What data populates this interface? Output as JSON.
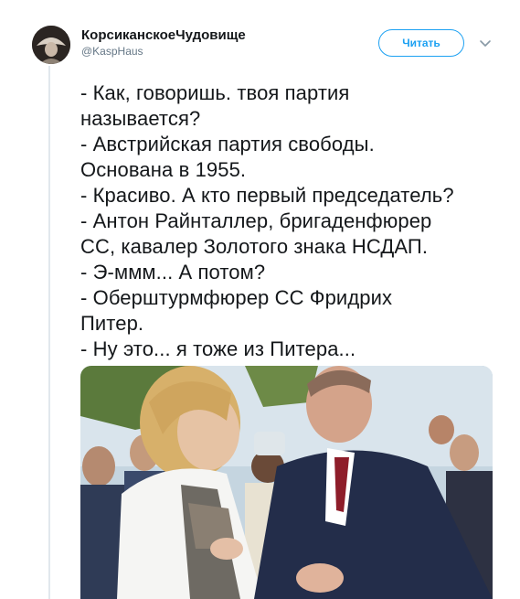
{
  "user": {
    "display_name": "КорсиканскоеЧудовище",
    "handle": "@KaspHaus"
  },
  "header": {
    "follow_label": "Читать",
    "menu_icon": "chevron-down-icon"
  },
  "tweet": {
    "lines": [
      "- Как, говоришь. твоя партия",
      "называется?",
      "- Австрийская партия свободы.",
      "Основана в 1955.",
      "- Красиво. А кто первый председатель?",
      "- Антон Райнталлер, бригаденфюрер",
      "СС, кавалер Золотого знака НСДАП.",
      "- Э-ммм... А потом?",
      "- Оберштурмфюрер СС Фридрих",
      "Питер.",
      "- Ну это... я тоже из Питера..."
    ]
  },
  "colors": {
    "accent": "#1da1f2",
    "text": "#14171a",
    "muted": "#657786",
    "divider": "#e1e8ed"
  },
  "media": {
    "icon": "photo-image"
  }
}
